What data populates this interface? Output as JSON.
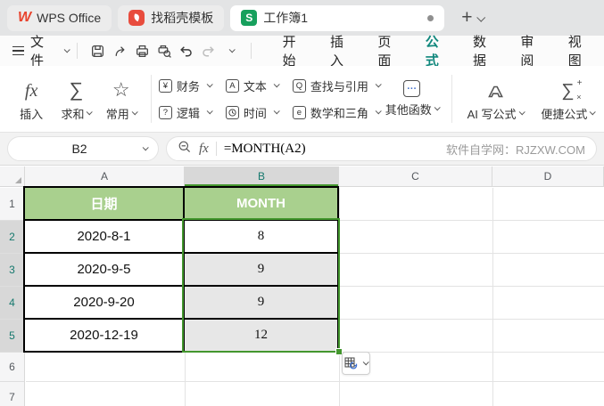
{
  "tabbar": {
    "tabs": [
      {
        "label": "WPS Office"
      },
      {
        "label": "找稻壳模板"
      },
      {
        "label": "工作簿1",
        "state": "active, unsaved"
      }
    ],
    "wps_logo_letter": "W",
    "sheet_icon_letter": "S",
    "new_tab_label": "+",
    "colors": {
      "wps_red": "#e8442e",
      "docer_red": "#e84c3d",
      "sheet_green": "#17a05d"
    }
  },
  "menubar": {
    "file_label": "文件",
    "tabs": [
      {
        "label": "开始"
      },
      {
        "label": "插入"
      },
      {
        "label": "页面"
      },
      {
        "label": "公式",
        "active": true
      },
      {
        "label": "数据"
      },
      {
        "label": "审阅"
      },
      {
        "label": "视图"
      }
    ],
    "active_tab": "公式",
    "accent_teal": "#0f877c"
  },
  "ribbon": {
    "insert_fn": {
      "icon": "fx",
      "label": "插入"
    },
    "sum": {
      "icon": "∑",
      "label": "求和"
    },
    "common": {
      "icon": "☆",
      "label": "常用"
    },
    "finance": {
      "icon": "¥",
      "label": "财务"
    },
    "logic": {
      "icon": "?",
      "label": "逻辑"
    },
    "text": {
      "icon": "A",
      "label": "文本"
    },
    "time": {
      "icon": "clock",
      "label": "时间"
    },
    "lookup": {
      "icon": "Q",
      "label": "查找与引用"
    },
    "math": {
      "icon": "e",
      "label": "数学和三角"
    },
    "other_fn": {
      "icon": "···",
      "label": "其他函数"
    },
    "ai": {
      "label": "AI 写公式"
    },
    "quick": {
      "icon": "∑",
      "plus": "+",
      "times": "×",
      "label": "便捷公式"
    }
  },
  "formula_bar": {
    "name_box_value": "B2",
    "fx_label": "fx",
    "formula": "=MONTH(A2)",
    "watermark": "软件自学网：RJZXW.COM"
  },
  "sheet": {
    "col_headers": [
      "A",
      "B",
      "C",
      "D"
    ],
    "row_headers": [
      "1",
      "2",
      "3",
      "4",
      "5",
      "6",
      "7"
    ],
    "selected_column": "B",
    "selected_rows": "2-5",
    "active_cell": "B2",
    "selection_range": "B2:B5",
    "table": {
      "col_a_header": "日期",
      "col_b_header": "MONTH",
      "rows": [
        {
          "date": "2020-8-1",
          "month": "8"
        },
        {
          "date": "2020-9-5",
          "month": "9"
        },
        {
          "date": "2020-9-20",
          "month": "9"
        },
        {
          "date": "2020-12-19",
          "month": "12"
        }
      ]
    },
    "colors": {
      "table_header_bg": "#a9d08e",
      "table_header_text": "#ffffff",
      "selection_border_green": "#43962e",
      "selected_header_bg": "#d8d8d8",
      "selected_header_text": "#15786d"
    }
  }
}
